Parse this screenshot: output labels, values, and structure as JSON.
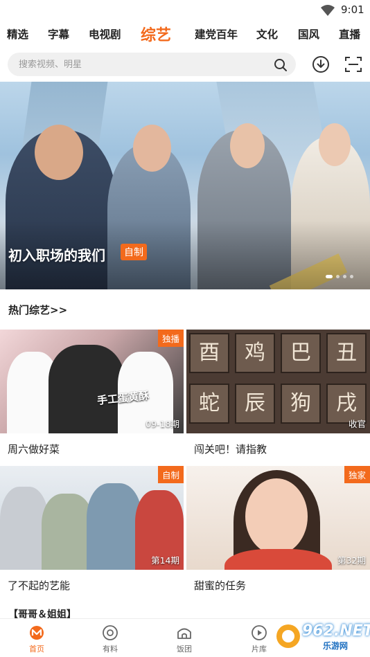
{
  "status": {
    "time": "9:01"
  },
  "tabs": [
    {
      "label": "精选"
    },
    {
      "label": "字幕"
    },
    {
      "label": "电视剧"
    },
    {
      "label": "综艺"
    },
    {
      "label": "建党百年"
    },
    {
      "label": "文化"
    },
    {
      "label": "国风"
    },
    {
      "label": "直播"
    }
  ],
  "active_tab": "综艺",
  "search": {
    "placeholder": "搜索视频、明星"
  },
  "banner": {
    "title": "初入职场的我们",
    "badge": "自制",
    "page_dots": 4,
    "active_dot": 1
  },
  "section": {
    "title": "热门综艺>>"
  },
  "cards": [
    {
      "name": "周六做好菜",
      "tag": "独播",
      "info": "09-18期",
      "art_text": "手工蛋黄酥"
    },
    {
      "name": "闯关吧！请指教",
      "tag": "",
      "info": "收官",
      "art_text": ""
    },
    {
      "name": "了不起的艺能",
      "tag": "自制",
      "info": "第14期",
      "art_text": ""
    },
    {
      "name": "甜蜜的任务",
      "tag": "独家",
      "info": "第32期",
      "art_text": ""
    }
  ],
  "tile_chars": [
    "酉",
    "鸡",
    "巴",
    "丑",
    "蛇",
    "辰",
    "狗",
    "戌"
  ],
  "next_section": {
    "title": "【哥哥＆姐姐】"
  },
  "bottom_nav": [
    {
      "label": "首页",
      "icon": "home-icon"
    },
    {
      "label": "有料",
      "icon": "discover-icon"
    },
    {
      "label": "饭团",
      "icon": "fan-group-icon"
    },
    {
      "label": "片库",
      "icon": "library-icon"
    }
  ],
  "watermark": {
    "text": "962.NET",
    "sub": "乐游网"
  },
  "colors": {
    "accent": "#f36a1c",
    "text": "#222222",
    "search_bg": "#f0f0f0"
  }
}
